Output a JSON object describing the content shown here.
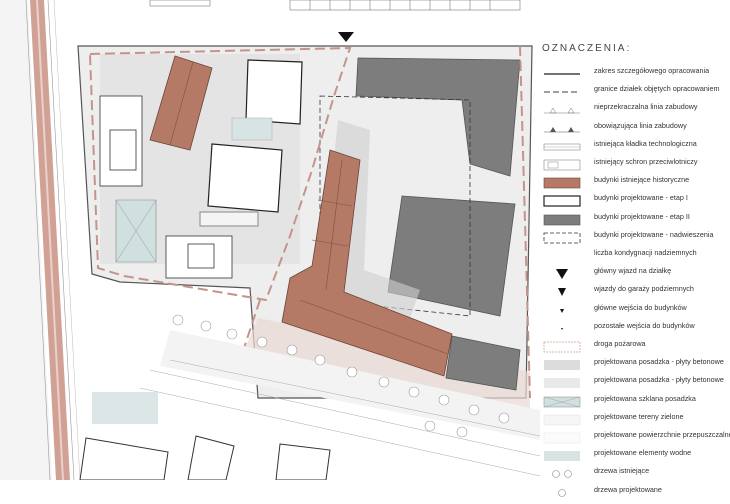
{
  "legend": {
    "title": "OZNACZENIA:",
    "items": [
      {
        "label": "zakres szczegółowego opracowania",
        "symbol": "solid-line-icon"
      },
      {
        "label": "granice działek objętych opracowaniem",
        "symbol": "dashed-line-icon"
      },
      {
        "label": "nieprzekraczalna linia zabudowy",
        "symbol": "open-triangle-line-icon"
      },
      {
        "label": "obowiązująca linia zabudowy",
        "symbol": "filled-triangle-line-icon"
      },
      {
        "label": "istniejąca kładka technologiczna",
        "symbol": "footbridge-icon"
      },
      {
        "label": "istniejący schron przeciwlotniczy",
        "symbol": "shelter-icon"
      },
      {
        "label": "budynki istniejące historyczne",
        "symbol": "historic-building-swatch"
      },
      {
        "label": "budynki projektowane - etap I",
        "symbol": "stage-1-swatch"
      },
      {
        "label": "budynki projektowane - etap II",
        "symbol": "stage-2-swatch"
      },
      {
        "label": "budynki projektowane - nadwieszenia",
        "symbol": "overhang-swatch"
      },
      {
        "label": "liczba kondygnacji nadziemnych",
        "symbol": "storeys-icon"
      },
      {
        "label": "główny wjazd na działkę",
        "symbol": "main-entry-triangle-icon"
      },
      {
        "label": "wjazdy do garaży podziemnych",
        "symbol": "garage-entry-triangle-icon"
      },
      {
        "label": "główne wejścia do budynków",
        "symbol": "main-door-triangle-icon"
      },
      {
        "label": "pozostałe wejścia do budynków",
        "symbol": "other-door-triangle-icon"
      },
      {
        "label": "droga pożarowa",
        "symbol": "fire-road-swatch"
      },
      {
        "label": "projektowana posadzka - płyty betonowe",
        "symbol": "concrete-paving-swatch"
      },
      {
        "label": "projektowana posadzka - płyty betonowe",
        "symbol": "concrete-paving-2-swatch"
      },
      {
        "label": "projektowana szklana posadzka",
        "symbol": "glass-floor-swatch"
      },
      {
        "label": "projektowane tereny zielone",
        "symbol": "green-area-swatch"
      },
      {
        "label": "projektowane powierzchnie przepuszczalne",
        "symbol": "permeable-surface-swatch"
      },
      {
        "label": "projektowane elementy wodne",
        "symbol": "water-swatch"
      },
      {
        "label": "drzewa istniejące",
        "symbol": "existing-tree-icon"
      },
      {
        "label": "drzewa projektowane",
        "symbol": "planned-tree-icon"
      }
    ]
  },
  "colors": {
    "historic": "#b57a66",
    "stage2": "#7d7d7d",
    "paving": "#dcdcdc",
    "paving_light": "#e9e9e9",
    "fire_road": "#c9a49a",
    "boundary": "#b88a80",
    "glass": "#cfe0df",
    "water": "#d8e4e4"
  }
}
